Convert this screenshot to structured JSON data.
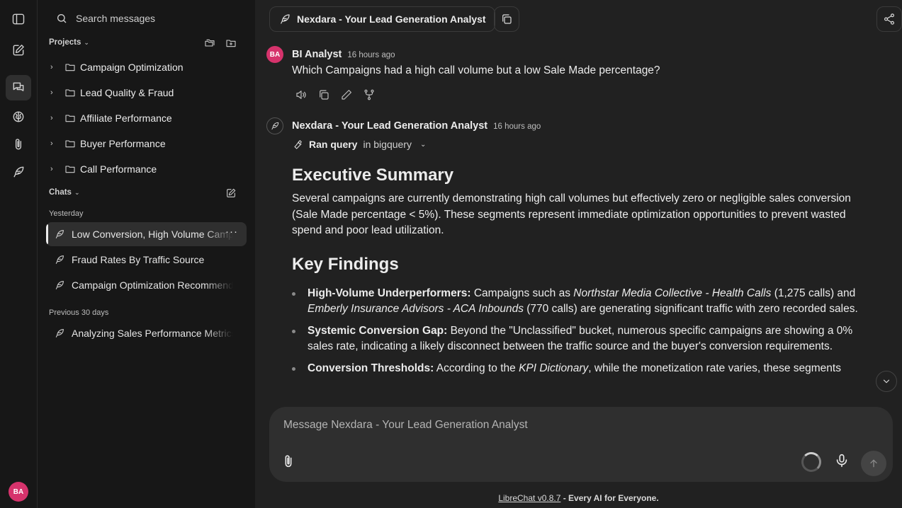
{
  "rail": {
    "avatar_initials": "BA",
    "icons": [
      "sidebar-toggle-icon",
      "new-chat-icon",
      "chats-icon",
      "brain-icon",
      "paperclip-icon",
      "feather-icon"
    ]
  },
  "sidebar": {
    "search_placeholder": "Search messages",
    "projects_label": "Projects",
    "projects": [
      {
        "label": "Campaign Optimization"
      },
      {
        "label": "Lead Quality & Fraud"
      },
      {
        "label": "Affiliate Performance"
      },
      {
        "label": "Buyer Performance"
      },
      {
        "label": "Call Performance"
      }
    ],
    "chats_label": "Chats",
    "groups": [
      {
        "label": "Yesterday"
      },
      {
        "label": "Previous 30 days"
      }
    ],
    "chats": [
      {
        "label": "Low Conversion, High Volume Campaigns"
      },
      {
        "label": "Fraud Rates By Traffic Source"
      },
      {
        "label": "Campaign Optimization Recommendations"
      },
      {
        "label": "Analyzing Sales Performance Metrics"
      }
    ],
    "more_label": "···"
  },
  "header": {
    "agent_title": "Nexdara - Your Lead Generation Analyst"
  },
  "conversation": {
    "user": {
      "initials": "BA",
      "name": "BI Analyst",
      "time": "16 hours ago",
      "text": "Which Campaigns had a high call volume but a low Sale Made percentage?"
    },
    "bot": {
      "name": "Nexdara - Your Lead Generation Analyst",
      "time": "16 hours ago",
      "tool_bold": "Ran query",
      "tool_rest": "in bigquery",
      "h1": "Executive Summary",
      "p1": "Several campaigns are currently demonstrating high call volumes but effectively zero or negligible sales conversion (Sale Made percentage < 5%). These segments represent immediate optimization opportunities to prevent wasted spend and poor lead utilization.",
      "h2": "Key Findings",
      "f1": {
        "b": "High-Volume Underperformers:",
        "t1": " Campaigns such as ",
        "i1": "Northstar Media Collective - Health Calls",
        "t2": " (1,275 calls) and ",
        "i2": "Emberly Insurance Advisors - ACA Inbounds",
        "t3": " (770 calls) are generating significant traffic with zero recorded sales."
      },
      "f2": {
        "b": "Systemic Conversion Gap:",
        "t1": " Beyond the \"Unclassified\" bucket, numerous specific campaigns are showing a 0% sales rate, indicating a likely disconnect between the traffic source and the buyer's conversion requirements."
      },
      "f3": {
        "b": "Conversion Thresholds:",
        "t1": " According to the ",
        "i1": "KPI Dictionary",
        "t2": ", while the monetization rate varies, these segments"
      }
    }
  },
  "composer": {
    "placeholder": "Message Nexdara - Your Lead Generation Analyst"
  },
  "footer": {
    "link": "LibreChat v0.8.7",
    "rest": " - Every AI for Everyone."
  }
}
